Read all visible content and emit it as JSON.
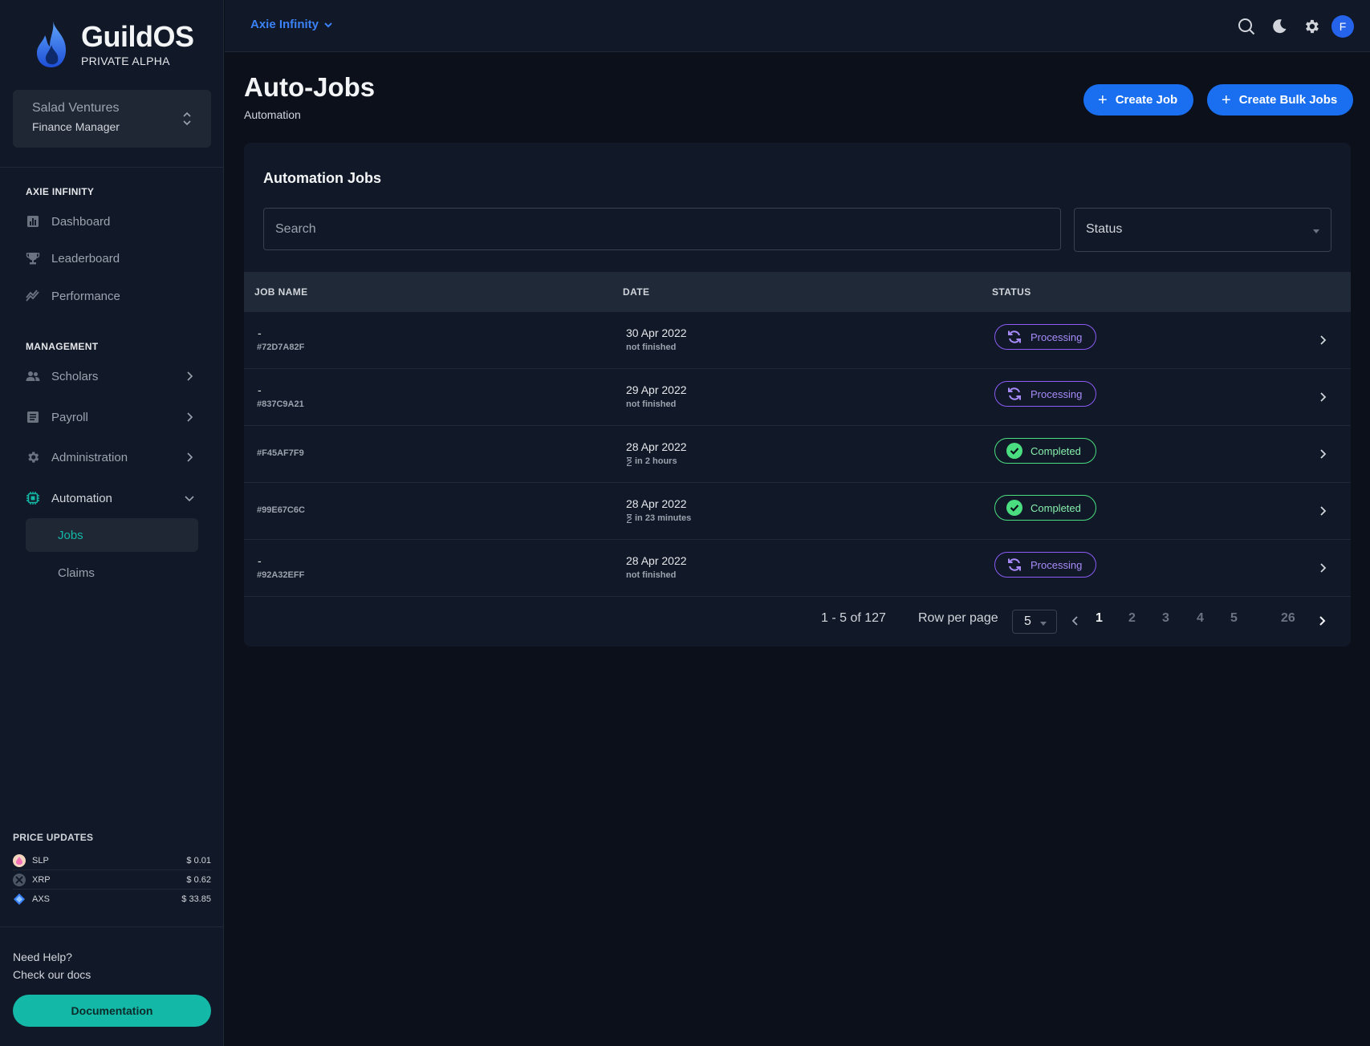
{
  "brand": {
    "title": "GuildOS",
    "subtitle": "PRIVATE ALPHA"
  },
  "org": {
    "name": "Salad Ventures",
    "role": "Finance Manager"
  },
  "sidebar": {
    "section1": "AXIE INFINITY",
    "dashboard": "Dashboard",
    "leaderboard": "Leaderboard",
    "performance": "Performance",
    "section2": "MANAGEMENT",
    "scholars": "Scholars",
    "payroll": "Payroll",
    "administration": "Administration",
    "automation": "Automation",
    "jobs": "Jobs",
    "claims": "Claims"
  },
  "prices": {
    "title": "PRICE UPDATES",
    "items": [
      {
        "symbol": "SLP",
        "value": "$ 0.01"
      },
      {
        "symbol": "XRP",
        "value": "$ 0.62"
      },
      {
        "symbol": "AXS",
        "value": "$ 33.85"
      }
    ]
  },
  "help": {
    "line1": "Need Help?",
    "line2": "Check our docs",
    "button": "Documentation"
  },
  "topbar": {
    "game": "Axie Infinity",
    "avatar": "F"
  },
  "page": {
    "title": "Auto-Jobs",
    "subtitle": "Automation",
    "create_job": "Create Job",
    "create_bulk": "Create Bulk Jobs"
  },
  "card": {
    "title": "Automation Jobs",
    "search_placeholder": "Search",
    "status_placeholder": "Status"
  },
  "table": {
    "headers": {
      "job": "JOB NAME",
      "date": "DATE",
      "status": "STATUS"
    },
    "rows": [
      {
        "name": "-",
        "id": "#72D7A82F",
        "date": "30 Apr 2022",
        "sub": "not finished",
        "hourglass": false,
        "status": "Processing",
        "kind": "proc"
      },
      {
        "name": "-",
        "id": "#837C9A21",
        "date": "29 Apr 2022",
        "sub": "not finished",
        "hourglass": false,
        "status": "Processing",
        "kind": "proc"
      },
      {
        "name": "",
        "id": "#F45AF7F9",
        "date": "28 Apr 2022",
        "sub": "in 2 hours",
        "hourglass": true,
        "status": "Completed",
        "kind": "comp"
      },
      {
        "name": "",
        "id": "#99E67C6C",
        "date": "28 Apr 2022",
        "sub": "in 23 minutes",
        "hourglass": true,
        "status": "Completed",
        "kind": "comp"
      },
      {
        "name": "-",
        "id": "#92A32EFF",
        "date": "28 Apr 2022",
        "sub": "not finished",
        "hourglass": false,
        "status": "Processing",
        "kind": "proc"
      }
    ]
  },
  "pagination": {
    "range": "1 - 5 of 127",
    "rows_label": "Row per page",
    "rows_value": "5",
    "pages": [
      "1",
      "2",
      "3",
      "4",
      "5",
      "26"
    ]
  }
}
